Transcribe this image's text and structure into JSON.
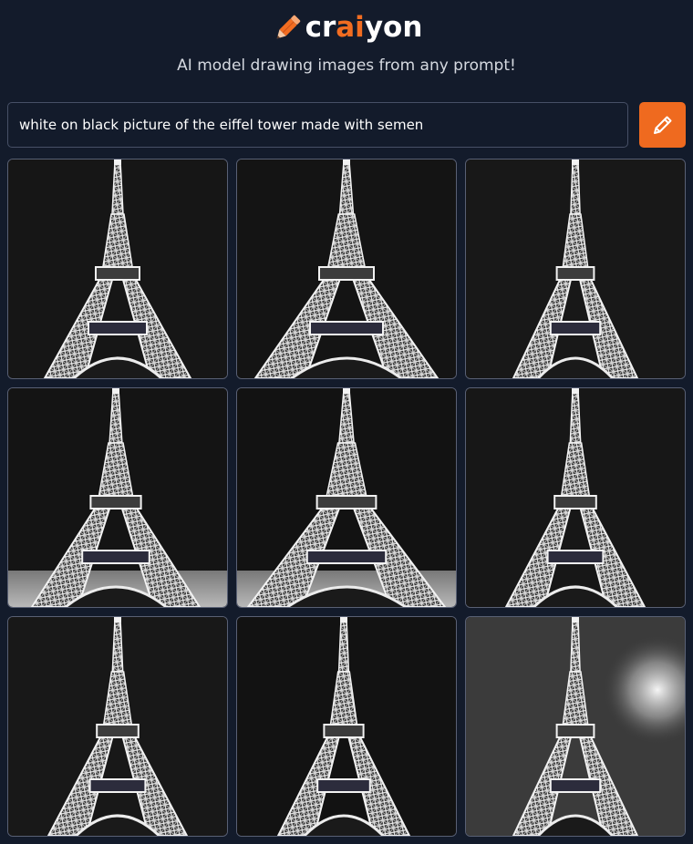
{
  "brand": {
    "icon": "pencil-icon",
    "name_prefix": "cr",
    "name_accent": "ai",
    "name_suffix": "yon",
    "accent_color": "#f26d21"
  },
  "tagline": "AI model drawing images from any prompt!",
  "prompt": {
    "value": "white on black picture of the eiffel tower made with semen"
  },
  "draw_button": {
    "icon": "pencil-icon",
    "color": "#ef6a1f"
  },
  "results": {
    "count": 9,
    "subject": "eiffel-tower-icon"
  },
  "colors": {
    "background": "#131b2b",
    "input_border": "#475066",
    "tile_border": "#596074"
  }
}
